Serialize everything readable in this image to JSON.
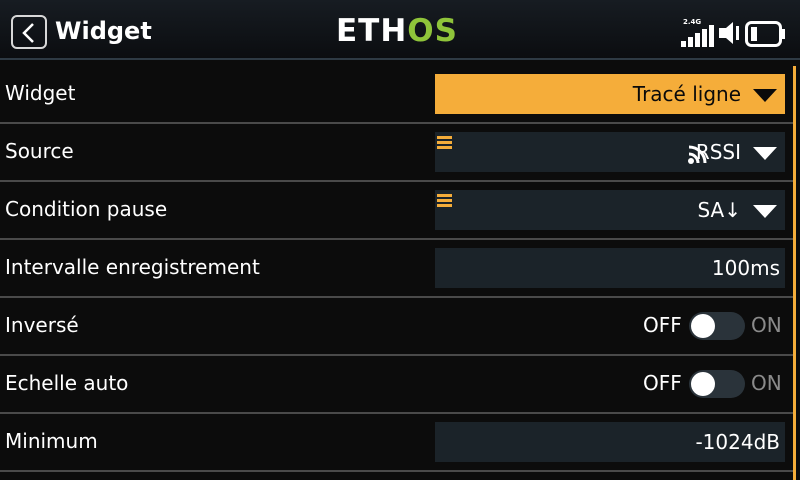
{
  "header": {
    "title": "Widget",
    "logo": {
      "part1": "ETH",
      "part2": "OS"
    },
    "band_label": "2.4G",
    "back_icon": "chevron-left-icon",
    "status_icons": [
      "signal-bars-icon",
      "speaker-icon",
      "battery-icon"
    ]
  },
  "colors": {
    "accent": "#f5ad3a",
    "logo_green": "#8fc43a",
    "field_bg": "#1b2329"
  },
  "rows": [
    {
      "label": "Widget",
      "value": "Tracé ligne"
    },
    {
      "label": "Source",
      "value": "RSSI",
      "icon": "rss-icon"
    },
    {
      "label": "Condition pause",
      "value": "SA↓"
    },
    {
      "label": "Intervalle enregistrement",
      "value": "100ms"
    },
    {
      "label": "Inversé",
      "off": "OFF",
      "on": "ON",
      "state": false
    },
    {
      "label": "Echelle auto",
      "off": "OFF",
      "on": "ON",
      "state": false
    },
    {
      "label": "Minimum",
      "value": "-1024dB"
    }
  ]
}
